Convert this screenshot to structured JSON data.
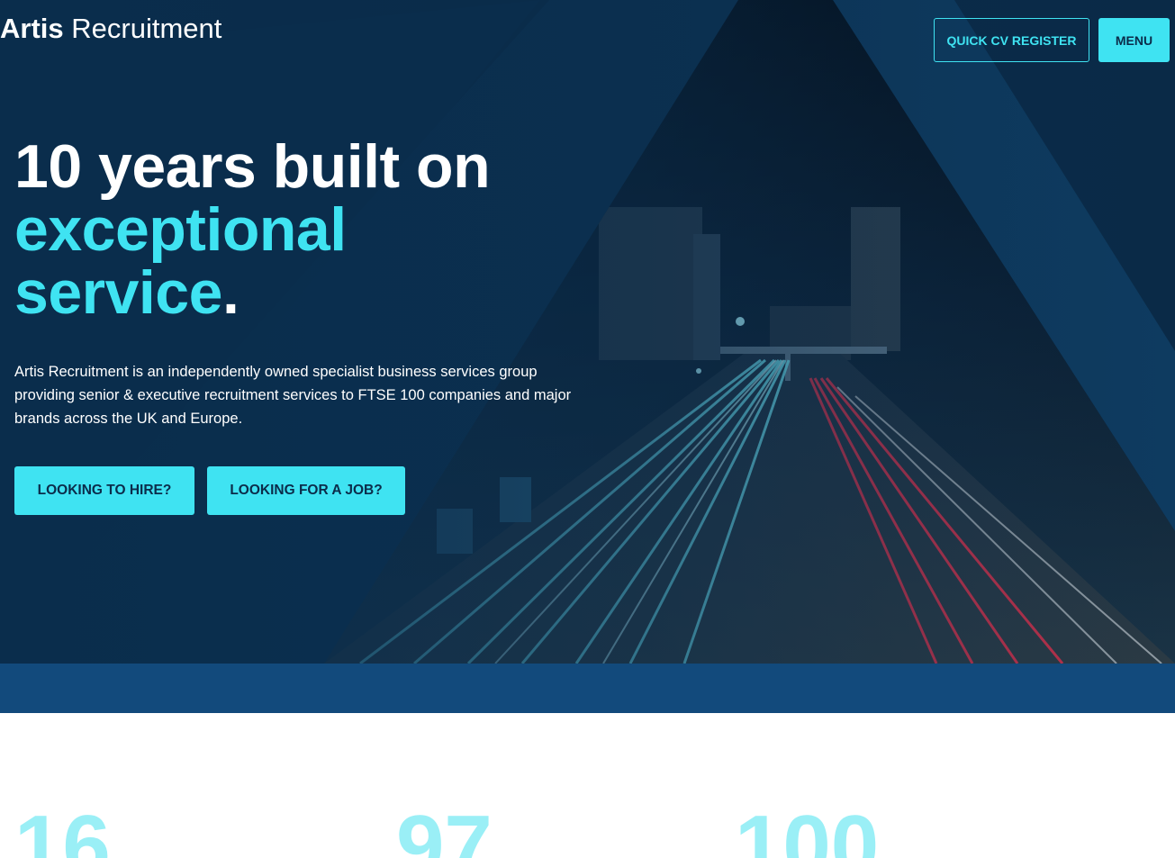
{
  "header": {
    "logo_bold": "Artis",
    "logo_light": "Recruitment",
    "quick_cv_label": "QUICK CV REGISTER",
    "menu_label": "MENU"
  },
  "hero": {
    "headline_line1": "10 years built on",
    "headline_accent1": "exceptional",
    "headline_accent2": "service",
    "headline_period": ".",
    "intro": "Artis Recruitment is an independently owned specialist business services group providing senior & executive recruitment services to FTSE 100 companies and major brands across the UK and Europe.",
    "cta_hire": "LOOKING TO HIRE?",
    "cta_job": "LOOKING FOR A JOB?"
  },
  "stats": {
    "values": [
      "16",
      "97",
      "100"
    ]
  },
  "colors": {
    "accent": "#3fe3f2",
    "navy": "#0a2d4c",
    "band": "#124a7c",
    "stat": "#9aeff6"
  }
}
